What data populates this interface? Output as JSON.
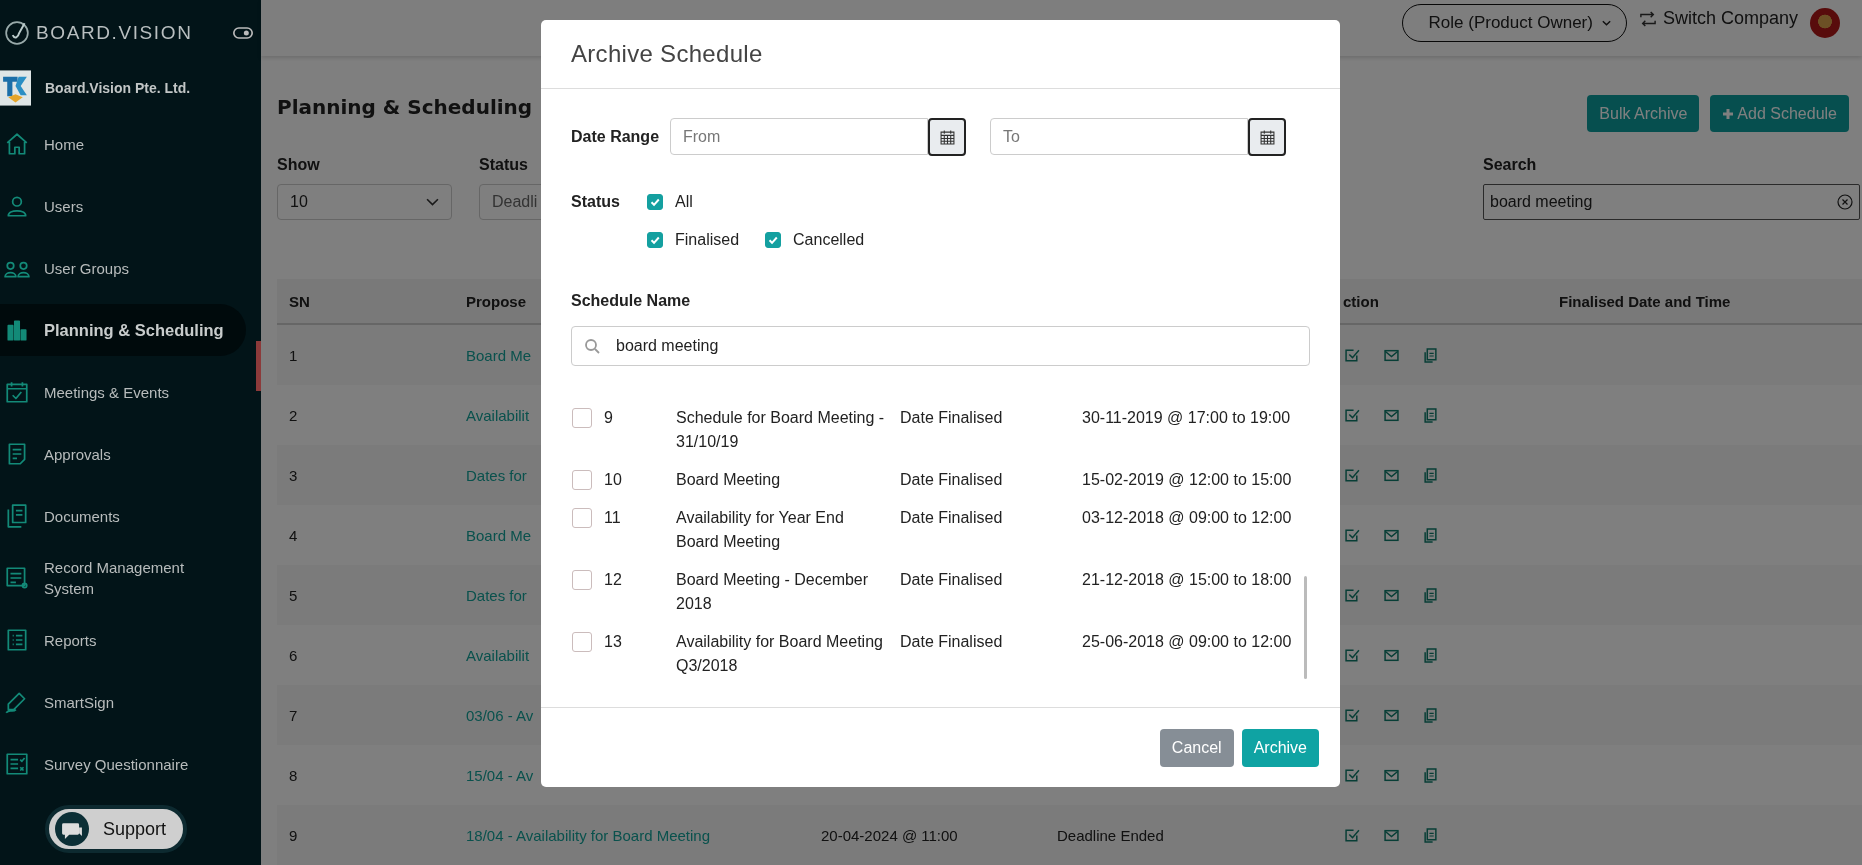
{
  "sidebar": {
    "brand": "BOARD.VISION",
    "company": "Board.Vision Pte. Ltd.",
    "items": [
      {
        "label": "Home",
        "selected": false
      },
      {
        "label": "Users",
        "selected": false
      },
      {
        "label": "User Groups",
        "selected": false
      },
      {
        "label": "Planning & Scheduling",
        "selected": true
      },
      {
        "label": "Meetings & Events",
        "selected": false
      },
      {
        "label": "Approvals",
        "selected": false
      },
      {
        "label": "Documents",
        "selected": false
      },
      {
        "label": "Record Management System",
        "selected": false
      },
      {
        "label": "Reports",
        "selected": false
      },
      {
        "label": "SmartSign",
        "selected": false
      },
      {
        "label": "Survey Questionnaire",
        "selected": false
      }
    ],
    "support": "Support"
  },
  "topbar": {
    "role": "Role (Product Owner)",
    "switch_company": "Switch Company"
  },
  "page": {
    "title": "Planning & Scheduling",
    "buttons": [
      "Bulk Archive",
      "Add Schedule"
    ],
    "show_label": "Show",
    "show_value": "10",
    "status_label": "Status",
    "status_value": "Deadli",
    "search_label": "Search",
    "search_value": "board meeting"
  },
  "table": {
    "columns": [
      "SN",
      "Propose",
      "ction",
      "Finalised Date and Time"
    ],
    "rows": [
      {
        "sn": "1",
        "name": "Board Me"
      },
      {
        "sn": "2",
        "name": "Availabilit"
      },
      {
        "sn": "3",
        "name": "Dates for"
      },
      {
        "sn": "4",
        "name": "Board Me"
      },
      {
        "sn": "5",
        "name": "Dates for"
      },
      {
        "sn": "6",
        "name": "Availabilit"
      },
      {
        "sn": "7",
        "name": "03/06 - Av"
      },
      {
        "sn": "8",
        "name": "15/04 - Av"
      },
      {
        "sn": "9",
        "name": "18/04 - Availability for Board Meeting",
        "date": "20-04-2024 @ 11:00",
        "status": "Deadline Ended"
      }
    ]
  },
  "dialog": {
    "title": "Archive Schedule",
    "date_range_label": "Date Range",
    "from_placeholder": "From",
    "to_placeholder": "To",
    "status_label": "Status",
    "statuses": [
      {
        "label": "All",
        "checked": true
      },
      {
        "label": "Finalised",
        "checked": true
      },
      {
        "label": "Cancelled",
        "checked": true
      }
    ],
    "schedule_name_label": "Schedule Name",
    "search_value": "board meeting",
    "rows": [
      {
        "sn": "9",
        "name": "Schedule for Board Meeting - 31/10/19",
        "status": "Date Finalised",
        "date": "30-11-2019 @ 17:00 to 19:00",
        "checked": false
      },
      {
        "sn": "10",
        "name": "Board Meeting",
        "status": "Date Finalised",
        "date": "15-02-2019 @ 12:00 to 15:00",
        "checked": false
      },
      {
        "sn": "11",
        "name": "Availability for Year End Board Meeting",
        "status": "Date Finalised",
        "date": "03-12-2018 @ 09:00 to 12:00",
        "checked": false
      },
      {
        "sn": "12",
        "name": "Board Meeting - December 2018",
        "status": "Date Finalised",
        "date": "21-12-2018 @ 15:00 to 18:00",
        "checked": false
      },
      {
        "sn": "13",
        "name": "Availability for Board Meeting Q3/2018",
        "status": "Date Finalised",
        "date": "25-06-2018 @ 09:00 to 12:00",
        "checked": false
      }
    ],
    "buttons": [
      "Cancel",
      "Archive"
    ]
  }
}
